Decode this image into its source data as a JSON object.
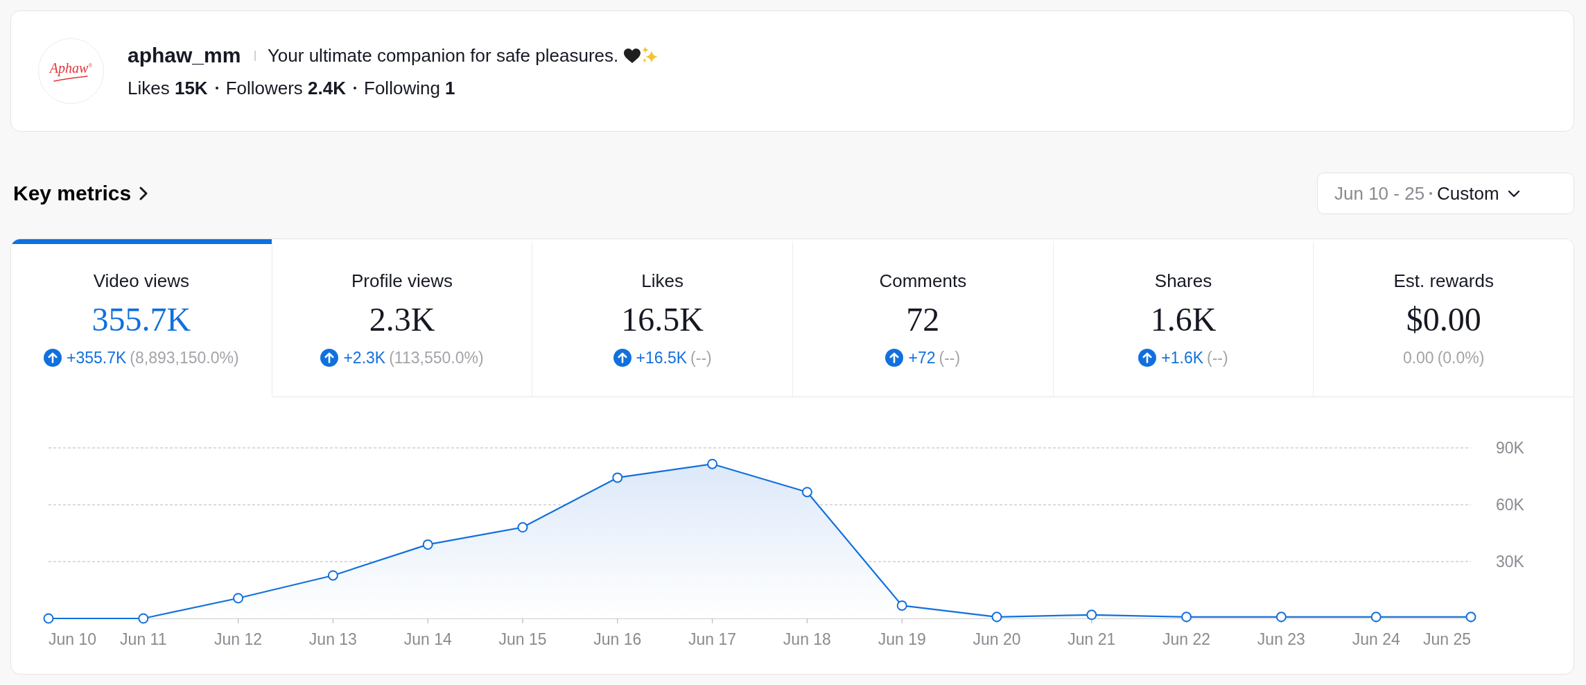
{
  "profile": {
    "avatar": {
      "logo_text": "Aphaw$^{®}$"
    },
    "username": "aphaw_mm",
    "bio": "Your ultimate companion for safe pleasures.",
    "stats": [
      {
        "label": "Likes",
        "value": "15K"
      },
      {
        "label": "Followers",
        "value": "2.4K"
      },
      {
        "label": "Following",
        "value": "1"
      }
    ]
  },
  "key_metrics": {
    "title": "Key metrics",
    "date_range": {
      "range": "Jun 10 - 25",
      "preset": "Custom"
    }
  },
  "metrics": [
    {
      "label": "Video views",
      "value": "355.7K",
      "change": "+355.7K",
      "percent": "(8,893,150.0%)",
      "kind": "increase",
      "selected": true
    },
    {
      "label": "Profile views",
      "value": "2.3K",
      "change": "+2.3K",
      "percent": "(113,550.0%)",
      "kind": "increase",
      "selected": false
    },
    {
      "label": "Likes",
      "value": "16.5K",
      "change": "+16.5K",
      "percent": "(--)",
      "kind": "increase",
      "selected": false
    },
    {
      "label": "Comments",
      "value": "72",
      "change": "+72",
      "percent": "(--)",
      "kind": "increase",
      "selected": false
    },
    {
      "label": "Shares",
      "value": "1.6K",
      "change": "+1.6K",
      "percent": "(--)",
      "kind": "increase",
      "selected": false
    },
    {
      "label": "Est. rewards",
      "value": "$0.00",
      "change": "0.00",
      "percent": "(0.0%)",
      "kind": "neutral",
      "selected": false
    }
  ],
  "chart": {
    "chart_data": {
      "type": "area",
      "categories": [
        "Jun 10",
        "Jun 11",
        "Jun 12",
        "Jun 13",
        "Jun 14",
        "Jun 15",
        "Jun 16",
        "Jun 17",
        "Jun 18",
        "Jun 19",
        "Jun 20",
        "Jun 21",
        "Jun 22",
        "Jun 23",
        "Jun 24",
        "Jun 25"
      ],
      "values": [
        0,
        0,
        10700,
        22700,
        39000,
        48100,
        74300,
        81500,
        66700,
        6800,
        800,
        1900,
        800,
        800,
        800,
        800
      ],
      "ylim": [
        0,
        90000
      ],
      "yticks": [
        {
          "value": 30000,
          "label": "30K"
        },
        {
          "value": 60000,
          "label": "60K"
        },
        {
          "value": 90000,
          "label": "90K"
        }
      ]
    }
  }
}
